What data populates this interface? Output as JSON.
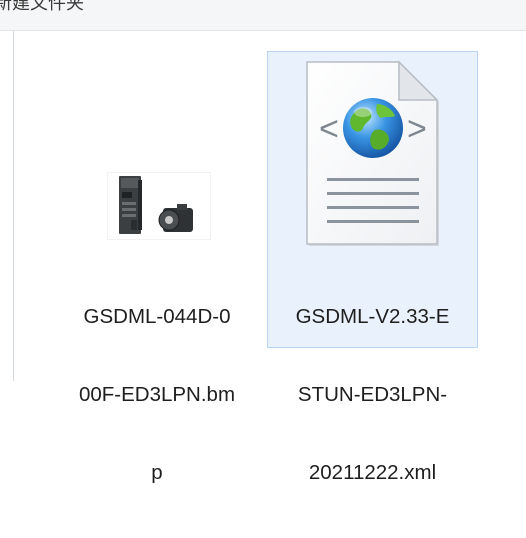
{
  "toolbar": {
    "new_folder_label": "新建文件夹"
  },
  "files": [
    {
      "name": "GSDML-044D-000F-ED3LPN.bmp",
      "label_lines": [
        "GSDML-044D-0",
        "00F-ED3LPN.bm",
        "p"
      ],
      "icon": "servo-drive-thumbnail",
      "selected": false
    },
    {
      "name": "GSDML-V2.33-ESTUN-ED3LPN-20211222.xml",
      "label_lines": [
        "GSDML-V2.33-E",
        "STUN-ED3LPN-",
        "20211222.xml"
      ],
      "icon": "xml-web-document-icon",
      "selected": true
    }
  ],
  "colors": {
    "selection_fill": "#e9f2fc",
    "selection_border": "#b9d4ef",
    "globe_blue": "#2d7fd8",
    "globe_green": "#5fb82e"
  }
}
